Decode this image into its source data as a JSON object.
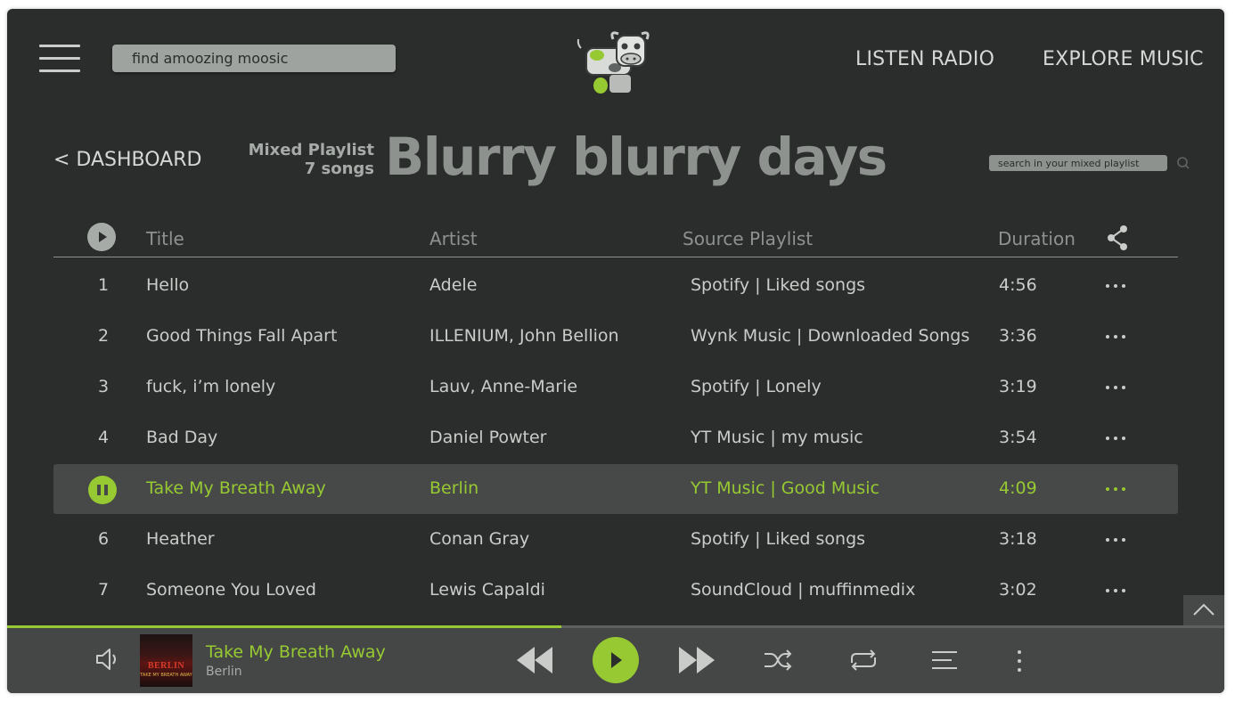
{
  "header": {
    "search_placeholder": "find amoozing moosic",
    "nav": {
      "radio": "LISTEN RADIO",
      "explore": "EXPLORE MUSIC"
    }
  },
  "playlist": {
    "back_label": "< DASHBOARD",
    "type_label": "Mixed Playlist",
    "count_label": "7 songs",
    "title": "Blurry blurry days",
    "search_placeholder": "search in your mixed playlist"
  },
  "table": {
    "columns": {
      "title": "Title",
      "artist": "Artist",
      "source": "Source Playlist",
      "duration": "Duration"
    },
    "rows": [
      {
        "num": "1",
        "title": "Hello",
        "artist": "Adele",
        "source": "Spotify | Liked songs",
        "duration": "4:56"
      },
      {
        "num": "2",
        "title": "Good Things Fall Apart",
        "artist": "ILLENIUM, John Bellion",
        "source": "Wynk Music | Downloaded Songs",
        "duration": "3:36"
      },
      {
        "num": "3",
        "title": "fuck, i’m lonely",
        "artist": "Lauv, Anne-Marie",
        "source": "Spotify | Lonely",
        "duration": "3:19"
      },
      {
        "num": "4",
        "title": "Bad Day",
        "artist": "Daniel Powter",
        "source": "YT Music | my music",
        "duration": "3:54"
      },
      {
        "num": "5",
        "title": "Take My Breath Away",
        "artist": "Berlin",
        "source": "YT Music | Good Music",
        "duration": "4:09",
        "playing": true
      },
      {
        "num": "6",
        "title": "Heather",
        "artist": "Conan Gray",
        "source": "Spotify | Liked songs",
        "duration": "3:18"
      },
      {
        "num": "7",
        "title": "Someone You Loved",
        "artist": "Lewis Capaldi",
        "source": "SoundCloud | muffinmedix",
        "duration": "3:02"
      }
    ]
  },
  "player": {
    "title": "Take My Breath Away",
    "artist": "Berlin",
    "cover_text": "BERLIN",
    "cover_subtext": "TAKE MY BREATH AWAY",
    "progress": 0.455
  },
  "colors": {
    "background": "#2b2d2c",
    "accent": "#97c933",
    "text": "#c9ccc9",
    "muted": "#8e928f",
    "active_row": "#464947",
    "player_bar": "#444746"
  },
  "icons": [
    "menu-icon",
    "cow-logo",
    "search-icon",
    "play-icon",
    "share-icon",
    "more-horizontal-icon",
    "pause-icon",
    "chevron-up-icon",
    "volume-icon",
    "previous-icon",
    "next-icon",
    "shuffle-icon",
    "repeat-icon",
    "queue-icon",
    "more-vertical-icon"
  ]
}
